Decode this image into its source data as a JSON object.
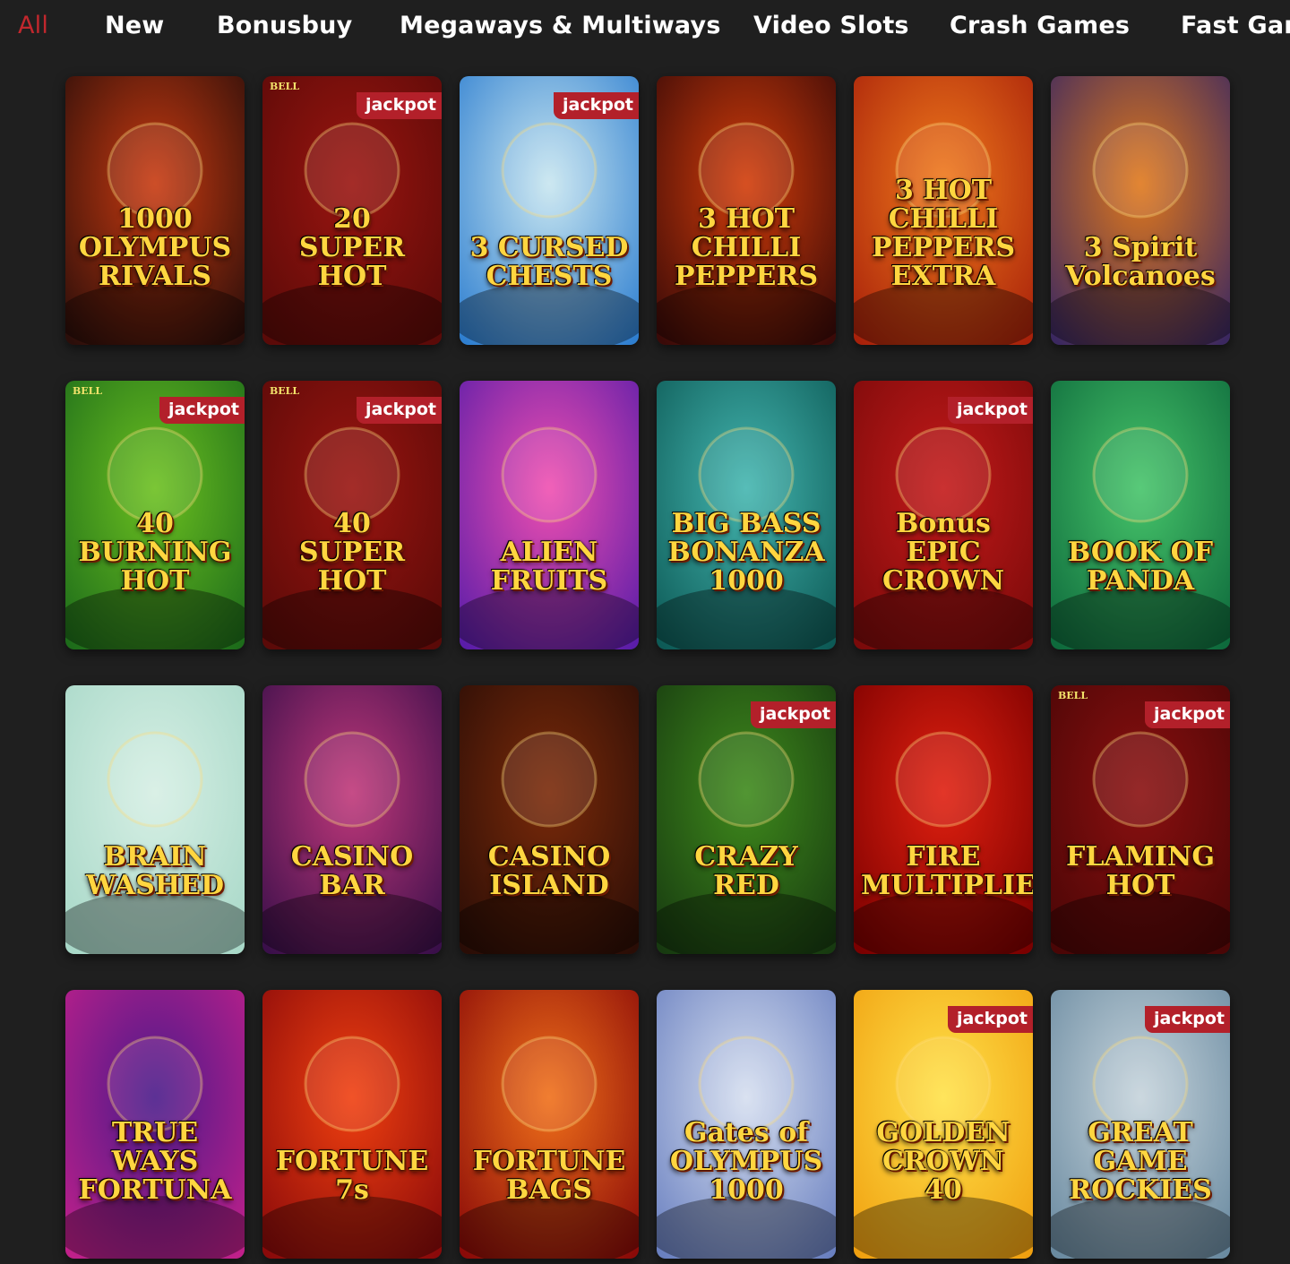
{
  "nav": {
    "items": [
      {
        "label": "All",
        "active": true
      },
      {
        "label": "New",
        "active": false
      },
      {
        "label": "Bonusbuy",
        "active": false
      },
      {
        "label": "Megaways & Multiways",
        "active": false
      },
      {
        "label": "Video Slots",
        "active": false
      },
      {
        "label": "Crash Games",
        "active": false
      },
      {
        "label": "Fast Gan",
        "active": false
      }
    ]
  },
  "colors": {
    "background": "#1f1f1f",
    "active": "#c1272d",
    "badge": "#b3202a"
  },
  "games": [
    {
      "title": "1000\nOLYMPUS\nRIVALS",
      "badge": "",
      "art": "olympus-rivals",
      "colors": [
        "#2b0e0a",
        "#c83a10"
      ]
    },
    {
      "title": "20\nSUPER HOT",
      "badge": "jackpot",
      "art": "seven-fruits",
      "brand": "BELL",
      "colors": [
        "#5a0a08",
        "#9a1510"
      ]
    },
    {
      "title": "3 CURSED\nCHESTS",
      "badge": "jackpot",
      "art": "pirate",
      "colors": [
        "#2f7fd0",
        "#c8e6f0"
      ]
    },
    {
      "title": "3 HOT\nCHILLI\nPEPPERS",
      "badge": "",
      "art": "chilli",
      "colors": [
        "#3a0a08",
        "#d23c0a"
      ]
    },
    {
      "title": "3 HOT CHILLI\nPEPPERS\nEXTRA",
      "badge": "",
      "art": "mexican",
      "colors": [
        "#a8210a",
        "#f07a1c"
      ]
    },
    {
      "title": "3 Spirit\nVolcanoes",
      "badge": "",
      "art": "volcano",
      "colors": [
        "#3b2860",
        "#e0781c"
      ]
    },
    {
      "title": "40\nBURNING\nHOT",
      "badge": "jackpot",
      "art": "clover",
      "brand": "BELL",
      "colors": [
        "#1d6c1a",
        "#6cc020"
      ]
    },
    {
      "title": "40\nSUPER\nHOT",
      "badge": "jackpot",
      "art": "seven-fruits",
      "brand": "BELL",
      "colors": [
        "#5a0a08",
        "#9a1510"
      ]
    },
    {
      "title": "ALIEN\nFRUITS",
      "badge": "",
      "art": "alien",
      "colors": [
        "#5a1da8",
        "#f04fb0"
      ]
    },
    {
      "title": "BIG BASS\nBONANZA\n1000",
      "badge": "",
      "art": "fisher",
      "colors": [
        "#0d5a56",
        "#44b6b0"
      ]
    },
    {
      "title": "Bonus\nEPIC\nCROWN",
      "badge": "jackpot",
      "art": "curtain",
      "colors": [
        "#7a0a0a",
        "#c41a1a"
      ]
    },
    {
      "title": "BOOK OF\nPANDA",
      "badge": "",
      "art": "panda",
      "colors": [
        "#0e6a3c",
        "#46c46a"
      ]
    },
    {
      "title": "BRAIN\nWASHED",
      "badge": "",
      "art": "brain",
      "colors": [
        "#a8d8c8",
        "#d6efe4"
      ]
    },
    {
      "title": "CASINO\nBAR",
      "badge": "",
      "art": "bar",
      "colors": [
        "#3a0f4a",
        "#c0387a"
      ]
    },
    {
      "title": "CASINO\nISLAND",
      "badge": "",
      "art": "seven-island",
      "colors": [
        "#2a0d06",
        "#7a2a0a"
      ]
    },
    {
      "title": "CRAZY\nRED",
      "badge": "jackpot",
      "art": "birds",
      "colors": [
        "#173a10",
        "#3f8a1c"
      ]
    },
    {
      "title": "FIRE\nMULTIPLIER",
      "badge": "",
      "art": "fire",
      "colors": [
        "#7a0000",
        "#e02010"
      ]
    },
    {
      "title": "FLAMING\nHOT",
      "badge": "jackpot",
      "art": "seven-flame",
      "brand": "BELL",
      "colors": [
        "#4a0606",
        "#8a1010"
      ]
    },
    {
      "title": "TRUE WAYS\nFORTUNA",
      "badge": "",
      "art": "fortuna",
      "colors": [
        "#c0208a",
        "#4a1a8a"
      ]
    },
    {
      "title": "FORTUNE\n7s",
      "badge": "",
      "art": "pot",
      "colors": [
        "#8a0a0a",
        "#f04010"
      ]
    },
    {
      "title": "FORTUNE\nBAGS",
      "badge": "",
      "art": "bags",
      "colors": [
        "#8a0a08",
        "#f0701a"
      ]
    },
    {
      "title": "Gates of\nOLYMPUS\n1000",
      "badge": "",
      "art": "zeus",
      "colors": [
        "#6a80c0",
        "#d6dff0"
      ]
    },
    {
      "title": "GOLDEN\nCROWN\n40",
      "badge": "jackpot",
      "art": "crown",
      "colors": [
        "#f0a010",
        "#ffe24a"
      ]
    },
    {
      "title": "GREAT\nGAME\nROCKIES",
      "badge": "jackpot",
      "art": "hunter",
      "colors": [
        "#6a8aa0",
        "#c6d4dc"
      ]
    }
  ]
}
